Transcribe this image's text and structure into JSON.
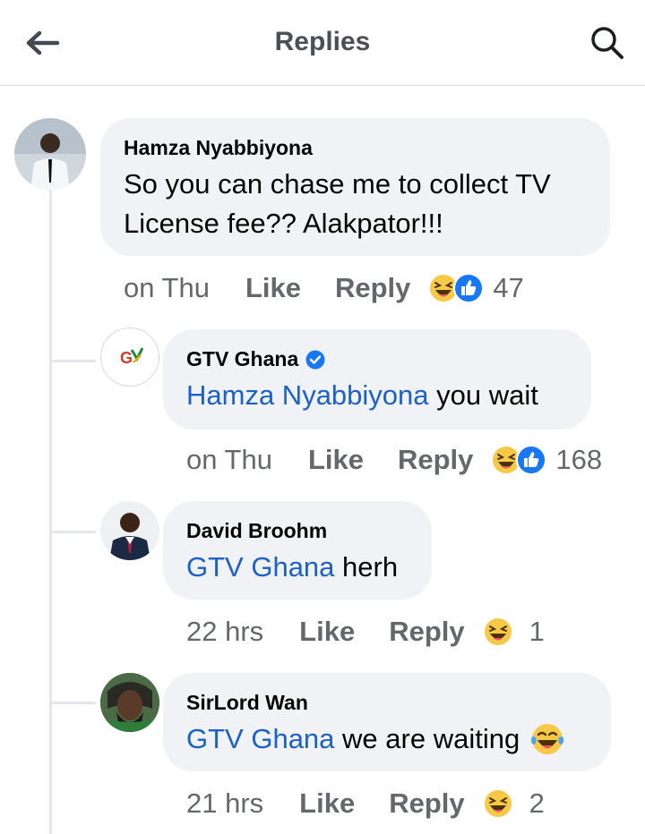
{
  "header": {
    "title": "Replies",
    "back_icon": "back-arrow-icon",
    "search_icon": "search-icon"
  },
  "colors": {
    "mention": "#1b61c7",
    "secondary_text": "#65676b",
    "bubble": "#f0f2f5",
    "verified": "#1877f2",
    "like": "#1877f2",
    "haha": "#f7c946"
  },
  "comments": [
    {
      "author": "Hamza Nyabbiyona",
      "text": "So you can chase me to collect TV",
      "text_line2": "License fee?? Alakpator!!!",
      "time": "on Thu",
      "like": "Like",
      "reply": "Reply",
      "reactions": [
        "haha",
        "like"
      ],
      "reaction_count": "47"
    },
    {
      "author": "GTV Ghana",
      "verified": true,
      "avatar_logo": "G",
      "mention": "Hamza Nyabbiyona",
      "text": " you wait",
      "time": "on Thu",
      "like": "Like",
      "reply": "Reply",
      "reactions": [
        "haha",
        "like"
      ],
      "reaction_count": "168"
    },
    {
      "author": "David Broohm",
      "mention": "GTV Ghana",
      "text": " herh",
      "time": "22 hrs",
      "like": "Like",
      "reply": "Reply",
      "reactions": [
        "haha"
      ],
      "reaction_count": "1"
    },
    {
      "author": "SirLord Wan",
      "mention": "GTV Ghana",
      "text": " we are waiting ",
      "emoji": "tears-of-joy",
      "time": "21 hrs",
      "like": "Like",
      "reply": "Reply",
      "reactions": [
        "haha"
      ],
      "reaction_count": "2"
    }
  ]
}
